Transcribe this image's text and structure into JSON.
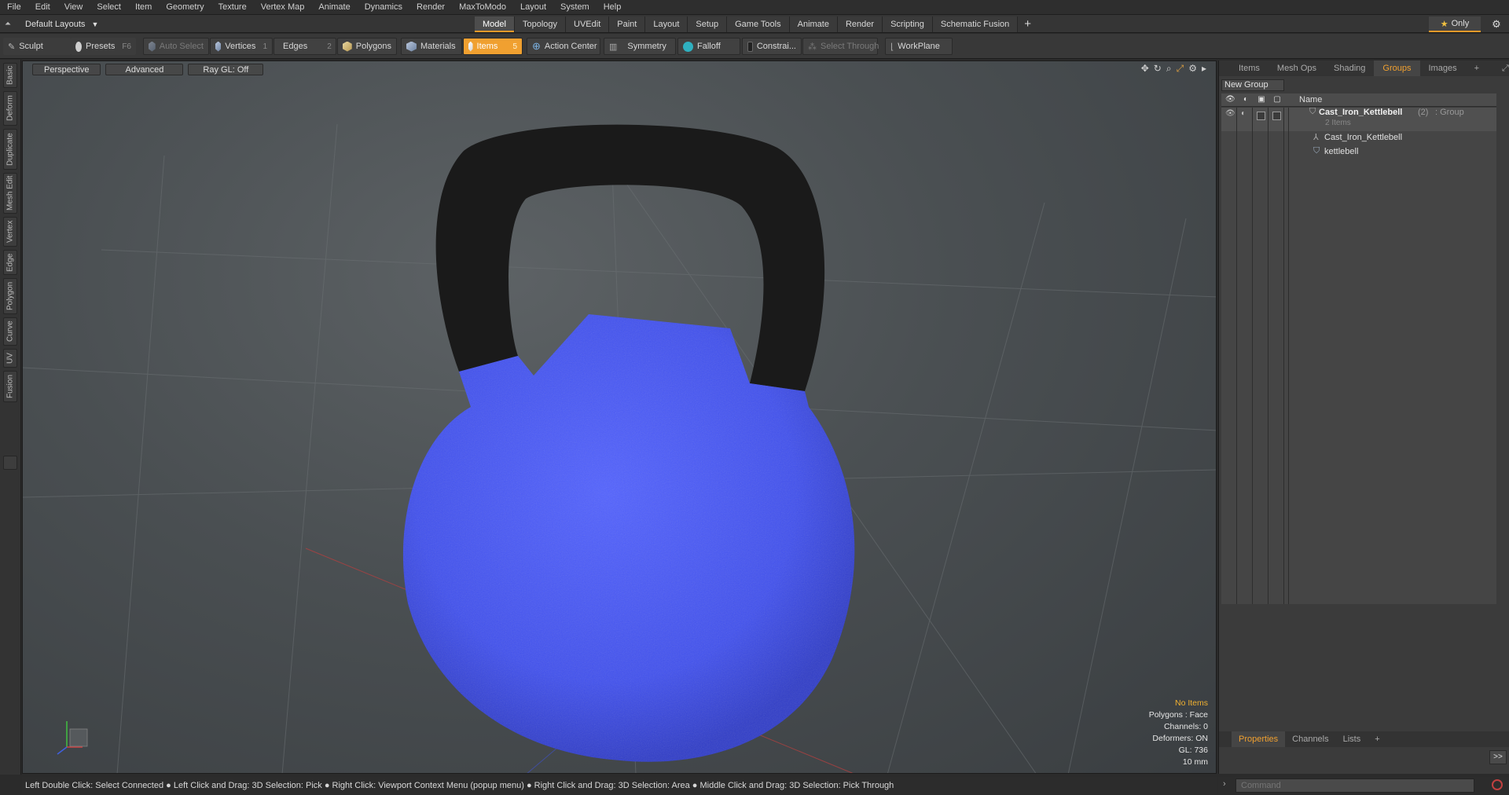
{
  "menubar": {
    "items": [
      "File",
      "Edit",
      "View",
      "Select",
      "Item",
      "Geometry",
      "Texture",
      "Vertex Map",
      "Animate",
      "Dynamics",
      "Render",
      "MaxToModo",
      "Layout",
      "System",
      "Help"
    ]
  },
  "layoutbar": {
    "layout_label": "Default Layouts",
    "tabs": [
      "Model",
      "Topology",
      "UVEdit",
      "Paint",
      "Layout",
      "Setup",
      "Game Tools",
      "Animate",
      "Render",
      "Scripting",
      "Schematic Fusion"
    ],
    "active_tab": "Model",
    "only_label": "Only"
  },
  "toolbar": {
    "sculpt": "Sculpt",
    "presets": "Presets",
    "presets_key": "F6",
    "auto_select": "Auto Select",
    "vertices": "Vertices",
    "vertices_key": "1",
    "edges": "Edges",
    "edges_key": "2",
    "polygons": "Polygons",
    "materials": "Materials",
    "items": "Items",
    "items_key": "5",
    "action_center": "Action Center",
    "symmetry": "Symmetry",
    "falloff": "Falloff",
    "constrain": "Constrai...",
    "select_through": "Select Through",
    "workplane": "WorkPlane",
    "accent": "#f0a030"
  },
  "leftbar": {
    "tabs": [
      "Basic",
      "Deform",
      "Duplicate",
      "Mesh Edit",
      "Vertex",
      "Edge",
      "Polygon",
      "Curve",
      "UV",
      "Fusion"
    ]
  },
  "viewport": {
    "view_mode": "Perspective",
    "shading": "Advanced",
    "raygl": "Ray GL: Off",
    "info": {
      "selection": "No Items",
      "polygons": "Polygons : Face",
      "channels": "Channels: 0",
      "deformers": "Deformers: ON",
      "gl": "GL: 736",
      "scale": "10 mm"
    },
    "object_colors": {
      "body": "#4858f0",
      "handle": "#1a1a1a"
    }
  },
  "rightpanel": {
    "tabs": [
      "Items",
      "Mesh Ops",
      "Shading",
      "Groups",
      "Images"
    ],
    "active_tab": "Groups",
    "new_group": "New Group",
    "name_col": "Name",
    "group_name": "Cast_Iron_Kettlebell",
    "group_count": "(2)",
    "group_type": ": Group",
    "group_items": "2 Items",
    "children": [
      "Cast_Iron_Kettlebell",
      "kettlebell"
    ],
    "bottom_tabs": [
      "Properties",
      "Channels",
      "Lists"
    ],
    "bottom_active": "Properties"
  },
  "statusbar": {
    "text": "Left Double Click: Select Connected ● Left Click and Drag: 3D Selection: Pick ● Right Click: Viewport Context Menu (popup menu) ● Right Click and Drag: 3D Selection: Area ● Middle Click and Drag: 3D Selection: Pick Through"
  },
  "command": {
    "placeholder": "Command"
  }
}
